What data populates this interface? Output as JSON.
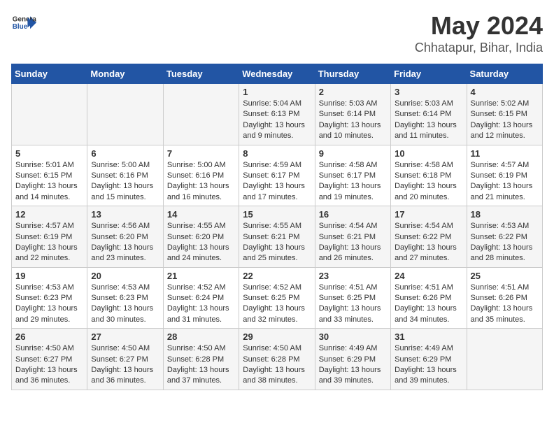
{
  "header": {
    "logo_general": "General",
    "logo_blue": "Blue",
    "month": "May 2024",
    "location": "Chhatapur, Bihar, India"
  },
  "weekdays": [
    "Sunday",
    "Monday",
    "Tuesday",
    "Wednesday",
    "Thursday",
    "Friday",
    "Saturday"
  ],
  "weeks": [
    [
      {
        "day": "",
        "text": ""
      },
      {
        "day": "",
        "text": ""
      },
      {
        "day": "",
        "text": ""
      },
      {
        "day": "1",
        "text": "Sunrise: 5:04 AM\nSunset: 6:13 PM\nDaylight: 13 hours\nand 9 minutes."
      },
      {
        "day": "2",
        "text": "Sunrise: 5:03 AM\nSunset: 6:14 PM\nDaylight: 13 hours\nand 10 minutes."
      },
      {
        "day": "3",
        "text": "Sunrise: 5:03 AM\nSunset: 6:14 PM\nDaylight: 13 hours\nand 11 minutes."
      },
      {
        "day": "4",
        "text": "Sunrise: 5:02 AM\nSunset: 6:15 PM\nDaylight: 13 hours\nand 12 minutes."
      }
    ],
    [
      {
        "day": "5",
        "text": "Sunrise: 5:01 AM\nSunset: 6:15 PM\nDaylight: 13 hours\nand 14 minutes."
      },
      {
        "day": "6",
        "text": "Sunrise: 5:00 AM\nSunset: 6:16 PM\nDaylight: 13 hours\nand 15 minutes."
      },
      {
        "day": "7",
        "text": "Sunrise: 5:00 AM\nSunset: 6:16 PM\nDaylight: 13 hours\nand 16 minutes."
      },
      {
        "day": "8",
        "text": "Sunrise: 4:59 AM\nSunset: 6:17 PM\nDaylight: 13 hours\nand 17 minutes."
      },
      {
        "day": "9",
        "text": "Sunrise: 4:58 AM\nSunset: 6:17 PM\nDaylight: 13 hours\nand 19 minutes."
      },
      {
        "day": "10",
        "text": "Sunrise: 4:58 AM\nSunset: 6:18 PM\nDaylight: 13 hours\nand 20 minutes."
      },
      {
        "day": "11",
        "text": "Sunrise: 4:57 AM\nSunset: 6:19 PM\nDaylight: 13 hours\nand 21 minutes."
      }
    ],
    [
      {
        "day": "12",
        "text": "Sunrise: 4:57 AM\nSunset: 6:19 PM\nDaylight: 13 hours\nand 22 minutes."
      },
      {
        "day": "13",
        "text": "Sunrise: 4:56 AM\nSunset: 6:20 PM\nDaylight: 13 hours\nand 23 minutes."
      },
      {
        "day": "14",
        "text": "Sunrise: 4:55 AM\nSunset: 6:20 PM\nDaylight: 13 hours\nand 24 minutes."
      },
      {
        "day": "15",
        "text": "Sunrise: 4:55 AM\nSunset: 6:21 PM\nDaylight: 13 hours\nand 25 minutes."
      },
      {
        "day": "16",
        "text": "Sunrise: 4:54 AM\nSunset: 6:21 PM\nDaylight: 13 hours\nand 26 minutes."
      },
      {
        "day": "17",
        "text": "Sunrise: 4:54 AM\nSunset: 6:22 PM\nDaylight: 13 hours\nand 27 minutes."
      },
      {
        "day": "18",
        "text": "Sunrise: 4:53 AM\nSunset: 6:22 PM\nDaylight: 13 hours\nand 28 minutes."
      }
    ],
    [
      {
        "day": "19",
        "text": "Sunrise: 4:53 AM\nSunset: 6:23 PM\nDaylight: 13 hours\nand 29 minutes."
      },
      {
        "day": "20",
        "text": "Sunrise: 4:53 AM\nSunset: 6:23 PM\nDaylight: 13 hours\nand 30 minutes."
      },
      {
        "day": "21",
        "text": "Sunrise: 4:52 AM\nSunset: 6:24 PM\nDaylight: 13 hours\nand 31 minutes."
      },
      {
        "day": "22",
        "text": "Sunrise: 4:52 AM\nSunset: 6:25 PM\nDaylight: 13 hours\nand 32 minutes."
      },
      {
        "day": "23",
        "text": "Sunrise: 4:51 AM\nSunset: 6:25 PM\nDaylight: 13 hours\nand 33 minutes."
      },
      {
        "day": "24",
        "text": "Sunrise: 4:51 AM\nSunset: 6:26 PM\nDaylight: 13 hours\nand 34 minutes."
      },
      {
        "day": "25",
        "text": "Sunrise: 4:51 AM\nSunset: 6:26 PM\nDaylight: 13 hours\nand 35 minutes."
      }
    ],
    [
      {
        "day": "26",
        "text": "Sunrise: 4:50 AM\nSunset: 6:27 PM\nDaylight: 13 hours\nand 36 minutes."
      },
      {
        "day": "27",
        "text": "Sunrise: 4:50 AM\nSunset: 6:27 PM\nDaylight: 13 hours\nand 36 minutes."
      },
      {
        "day": "28",
        "text": "Sunrise: 4:50 AM\nSunset: 6:28 PM\nDaylight: 13 hours\nand 37 minutes."
      },
      {
        "day": "29",
        "text": "Sunrise: 4:50 AM\nSunset: 6:28 PM\nDaylight: 13 hours\nand 38 minutes."
      },
      {
        "day": "30",
        "text": "Sunrise: 4:49 AM\nSunset: 6:29 PM\nDaylight: 13 hours\nand 39 minutes."
      },
      {
        "day": "31",
        "text": "Sunrise: 4:49 AM\nSunset: 6:29 PM\nDaylight: 13 hours\nand 39 minutes."
      },
      {
        "day": "",
        "text": ""
      }
    ]
  ]
}
